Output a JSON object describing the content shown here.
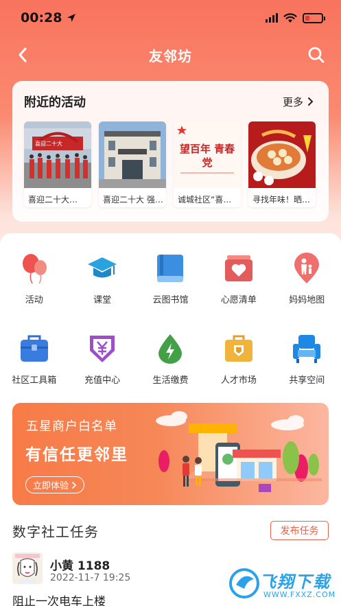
{
  "status_bar": {
    "time": "00:28",
    "icons": [
      "location-arrow-icon",
      "signal-icon",
      "wifi-icon",
      "battery-icon"
    ]
  },
  "nav": {
    "title": "友邻坊",
    "back_icon": "back-chevron-icon",
    "search_icon": "search-icon"
  },
  "nearby": {
    "title": "附近的活动",
    "more_label": "更多",
    "activities": [
      {
        "label": "喜迎二十大…",
        "img_text": "喜迎二十大"
      },
      {
        "label": "喜迎二十大 强…",
        "img_text": ""
      },
      {
        "label": "诚城社区“喜…",
        "img_text": "望百年 青春 党"
      },
      {
        "label": "寻找年味！晒…",
        "img_text": ""
      }
    ]
  },
  "services": [
    {
      "label": "活动",
      "icon": "balloons-icon"
    },
    {
      "label": "课堂",
      "icon": "graduation-cap-icon"
    },
    {
      "label": "云图书馆",
      "icon": "book-icon"
    },
    {
      "label": "心愿清单",
      "icon": "heart-box-icon"
    },
    {
      "label": "妈妈地图",
      "icon": "parent-child-pin-icon"
    },
    {
      "label": "社区工具箱",
      "icon": "toolbox-icon"
    },
    {
      "label": "充值中心",
      "icon": "yuan-shield-icon"
    },
    {
      "label": "生活缴费",
      "icon": "energy-drop-icon"
    },
    {
      "label": "人才市场",
      "icon": "briefcase-icon"
    },
    {
      "label": "共享空间",
      "icon": "armchair-icon"
    }
  ],
  "banner": {
    "title1": "五星商户白名单",
    "title2": "有信任更邻里",
    "button": "立即体验"
  },
  "tasks": {
    "title": "数字社工任务",
    "publish_label": "发布任务",
    "items": [
      {
        "user": "小黄 1188",
        "date": "2022-11-7 19:25",
        "text": "阻止一次电车上楼"
      }
    ]
  },
  "watermark": {
    "text": "飞翔下载",
    "sub": "WWW.FXXZ.COM"
  },
  "colors": {
    "accent": "#f9735e",
    "publish": "#e8604a"
  }
}
